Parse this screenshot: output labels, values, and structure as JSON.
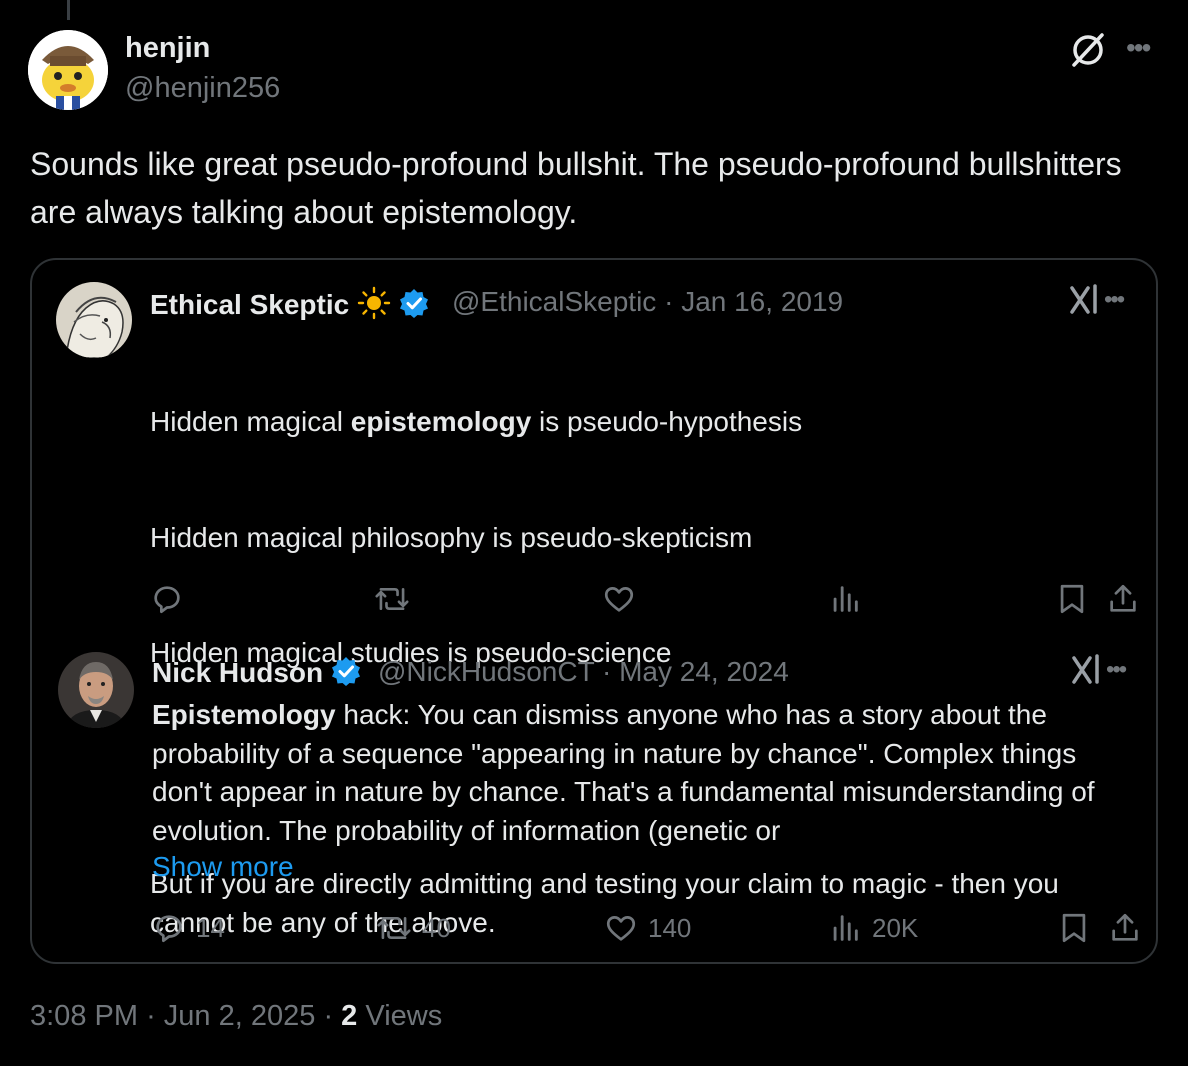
{
  "post": {
    "author_name": "henjin",
    "author_handle": "@henjin256",
    "text": "Sounds like great pseudo-profound bullshit. The pseudo-profound bullshitters are always talking about epistemology.",
    "time": "3:08 PM",
    "date": "Jun 2, 2025",
    "views_count": "2",
    "views_label": "Views"
  },
  "quote1": {
    "name": "Ethical Skeptic",
    "handle": "@EthicalSkeptic",
    "date": "Jan 16, 2019",
    "line1_pre": "Hidden magical ",
    "line1_bold": "epistemology",
    "line1_post": " is pseudo-hypothesis",
    "line2": "Hidden magical philosophy is pseudo-skepticism",
    "line3": "Hidden magical studies is pseudo-science",
    "line4": "But if you are directly admitting and testing your claim to magic - then you cannot be any of the above."
  },
  "quote2": {
    "name": "Nick Hudson",
    "handle": "@NickHudsonCT",
    "date": "May 24, 2024",
    "text_bold": "Epistemology",
    "text_rest": " hack: You can dismiss anyone who has a story about the probability of a sequence \"appearing in nature by chance\". Complex things don't appear in nature by chance. That's a fundamental misunderstanding of evolution. The probability of information (genetic or",
    "show_more": "Show more",
    "replies": "14",
    "reposts": "40",
    "likes": "140",
    "views": "20K"
  },
  "separator": "·",
  "icons": {
    "grok": "grok-icon",
    "more": "more-dots-icon",
    "reply": "reply-icon",
    "repost": "repost-icon",
    "like": "heart-icon",
    "views": "analytics-icon",
    "bookmark": "bookmark-icon",
    "share": "share-icon",
    "verified": "verified-badge-icon",
    "sun": "sun-emoji-icon"
  },
  "colors": {
    "background": "#000000",
    "text": "#e7e9ea",
    "secondary": "#71767b",
    "link": "#1d9bf0",
    "verified": "#1d9bf0",
    "border": "#2f3336"
  }
}
